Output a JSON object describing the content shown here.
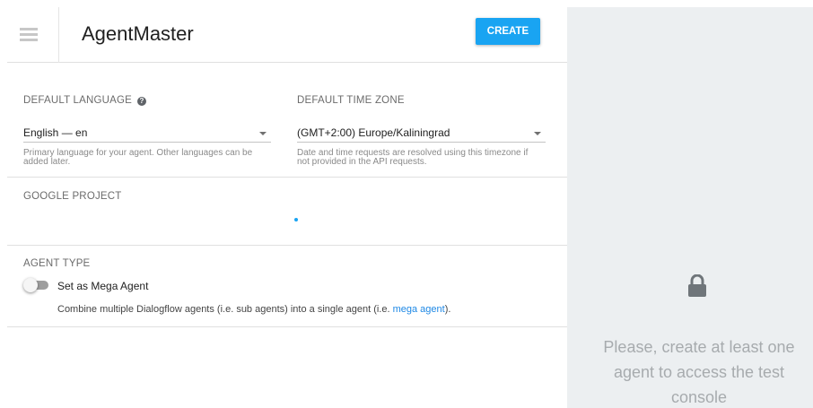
{
  "header": {
    "agent_name": "AgentMaster",
    "create_label": "CREATE"
  },
  "language": {
    "label": "DEFAULT LANGUAGE",
    "value": "English — en",
    "hint_line1": "Primary language for your agent. Other languages can be",
    "hint_line2": "added later."
  },
  "timezone": {
    "label": "DEFAULT TIME ZONE",
    "value": "(GMT+2:00) Europe/Kaliningrad",
    "hint_line1": "Date and time requests are resolved using this timezone if",
    "hint_line2": "not provided in the API requests."
  },
  "google_project": {
    "label": "GOOGLE PROJECT"
  },
  "agent_type": {
    "label": "AGENT TYPE",
    "toggle_label": "Set as Mega Agent",
    "toggle_on": false,
    "description_prefix": "Combine multiple Dialogflow agents (i.e. sub agents) into a single agent (i.e. ",
    "description_link": "mega agent",
    "description_suffix": ")."
  },
  "test_console": {
    "icon": "lock-icon",
    "message_line1": "Please, create at least one",
    "message_line2": "agent to access the test",
    "message_line3": "console"
  },
  "colors": {
    "accent": "#19a4f2",
    "link": "#1e88e5",
    "side_panel_bg": "#eceff1"
  }
}
